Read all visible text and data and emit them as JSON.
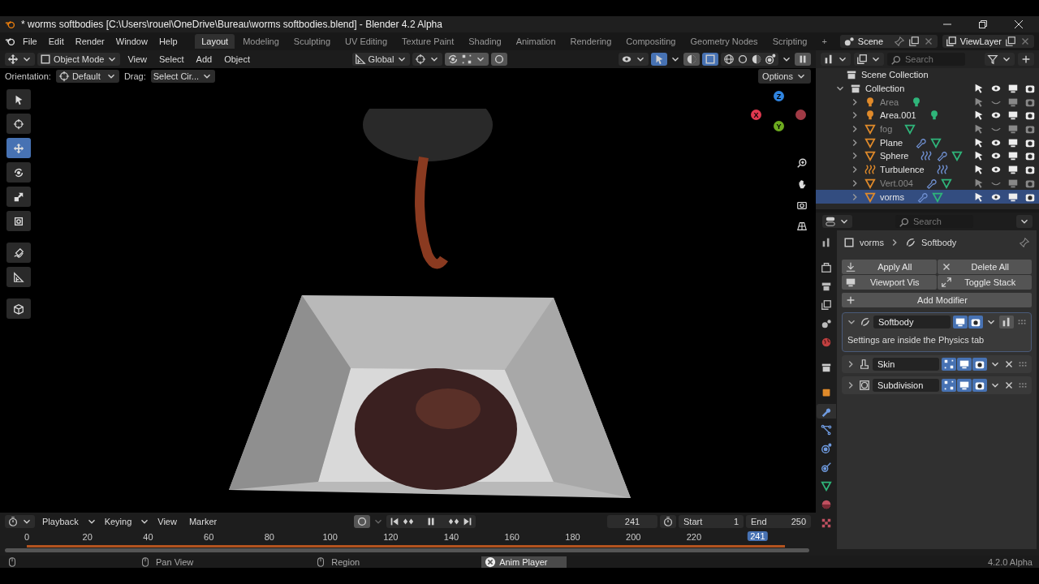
{
  "window": {
    "title": "* worms softbodies [C:\\Users\\rouel\\OneDrive\\Bureau\\worms softbodies.blend] - Blender 4.2 Alpha"
  },
  "menu": [
    "File",
    "Edit",
    "Render",
    "Window",
    "Help"
  ],
  "workspaces": [
    {
      "label": "Layout",
      "selected": true
    },
    {
      "label": "Modeling",
      "selected": false
    },
    {
      "label": "Sculpting",
      "selected": false
    },
    {
      "label": "UV Editing",
      "selected": false
    },
    {
      "label": "Texture Paint",
      "selected": false
    },
    {
      "label": "Shading",
      "selected": false
    },
    {
      "label": "Animation",
      "selected": false
    },
    {
      "label": "Rendering",
      "selected": false
    },
    {
      "label": "Compositing",
      "selected": false
    },
    {
      "label": "Geometry Nodes",
      "selected": false
    },
    {
      "label": "Scripting",
      "selected": false
    }
  ],
  "add_workspace": "+",
  "scene": "Scene",
  "view_layer": "ViewLayer",
  "viewport_header": {
    "mode": "Object Mode",
    "menus": [
      "View",
      "Select",
      "Add",
      "Object"
    ],
    "orientation": "Global"
  },
  "tool_settings": {
    "orientation_label": "Orientation:",
    "orientation": "Default",
    "drag_label": "Drag:",
    "drag": "Select Cir...",
    "options": "Options"
  },
  "tools": [
    {
      "kind": "select",
      "selected": false
    },
    {
      "kind": "cursor",
      "selected": false
    },
    {
      "kind": "move",
      "selected": true
    },
    {
      "kind": "rotate",
      "selected": false
    },
    {
      "kind": "scale",
      "selected": false
    },
    {
      "kind": "transform",
      "selected": false
    },
    {
      "kind": "annotate",
      "selected": false
    },
    {
      "kind": "measure",
      "selected": false
    },
    {
      "kind": "cube",
      "selected": false
    }
  ],
  "gizmo": [
    {
      "label": "Z",
      "color": "#2f84e0"
    },
    {
      "label": "Y",
      "color": "#6dab1f"
    },
    {
      "label": "X",
      "color": "#e0394f"
    }
  ],
  "outliner": {
    "search": {
      "placeholder": "Search"
    },
    "root": "Scene Collection",
    "collection": {
      "name": "Collection",
      "expanded": true,
      "children": [
        {
          "name": "Area",
          "kind": "light",
          "visible": false,
          "selected": false,
          "badges": [
            {
              "kind": "light"
            }
          ]
        },
        {
          "name": "Area.001",
          "kind": "light",
          "visible": true,
          "selected": false,
          "badges": [
            {
              "kind": "light"
            }
          ]
        },
        {
          "name": "fog",
          "kind": "mesh",
          "visible": false,
          "selected": false,
          "badges": [
            {
              "kind": "mesh"
            }
          ]
        },
        {
          "name": "Plane",
          "kind": "mesh",
          "visible": true,
          "selected": false,
          "badges": [
            {
              "kind": "wrench"
            },
            {
              "kind": "mesh"
            }
          ]
        },
        {
          "name": "Sphere",
          "kind": "mesh",
          "visible": true,
          "selected": false,
          "badges": [
            {
              "kind": "force"
            },
            {
              "kind": "wrench"
            },
            {
              "kind": "mesh"
            }
          ]
        },
        {
          "name": "Turbulence",
          "kind": "force",
          "visible": true,
          "selected": false,
          "badges": [
            {
              "kind": "force"
            }
          ]
        },
        {
          "name": "Vert.004",
          "kind": "mesh",
          "visible": false,
          "selected": false,
          "badges": [
            {
              "kind": "wrench"
            },
            {
              "kind": "mesh"
            }
          ]
        },
        {
          "name": "vorms",
          "kind": "mesh",
          "visible": true,
          "selected": true,
          "badges": [
            {
              "kind": "wrench"
            },
            {
              "kind": "mesh"
            }
          ]
        }
      ]
    }
  },
  "properties": {
    "search": {
      "placeholder": "Search"
    },
    "tabs": [
      {
        "kind": "tool",
        "selected": false
      },
      {
        "kind": "render",
        "selected": false
      },
      {
        "kind": "output",
        "selected": false
      },
      {
        "kind": "view_layer",
        "selected": false
      },
      {
        "kind": "scene",
        "selected": false
      },
      {
        "kind": "world",
        "selected": false
      },
      {
        "kind": "collection",
        "selected": false
      },
      {
        "kind": "object",
        "selected": false
      },
      {
        "kind": "modifier",
        "selected": true
      },
      {
        "kind": "particles",
        "selected": false
      },
      {
        "kind": "physics",
        "selected": false
      },
      {
        "kind": "constraints",
        "selected": false
      },
      {
        "kind": "data",
        "selected": false
      },
      {
        "kind": "material",
        "selected": false
      },
      {
        "kind": "texture",
        "selected": false
      }
    ],
    "breadcrumb": [
      "vorms",
      "Softbody"
    ],
    "actions": [
      "Apply All",
      "Delete All",
      "Viewport Vis",
      "Toggle Stack"
    ],
    "add_modifier": "Add Modifier",
    "modifiers": [
      {
        "name": "Softbody",
        "kind": "softbody",
        "expanded": true,
        "note": "Settings are inside the Physics tab"
      },
      {
        "name": "Skin",
        "kind": "skin",
        "expanded": false
      },
      {
        "name": "Subdivision",
        "kind": "subdivision",
        "expanded": false
      }
    ]
  },
  "timeline": {
    "menus": [
      "Playback",
      "Keying",
      "View",
      "Marker"
    ],
    "current_frame": "241",
    "start_label": "Start",
    "start": "1",
    "end_label": "End",
    "end": "250",
    "ticks": [
      "0",
      "20",
      "40",
      "60",
      "80",
      "100",
      "120",
      "140",
      "160",
      "180",
      "200",
      "220"
    ],
    "playhead": {
      "label": "241",
      "level": 0.964
    }
  },
  "status_bar": [
    {
      "kind": "mouse"
    },
    {
      "kind": "mouse",
      "label": "Pan View"
    },
    {
      "kind": "mouse",
      "label": "Region"
    },
    {
      "kind": "job",
      "label": "Anim Player"
    }
  ],
  "version": "4.2.0 Alpha"
}
